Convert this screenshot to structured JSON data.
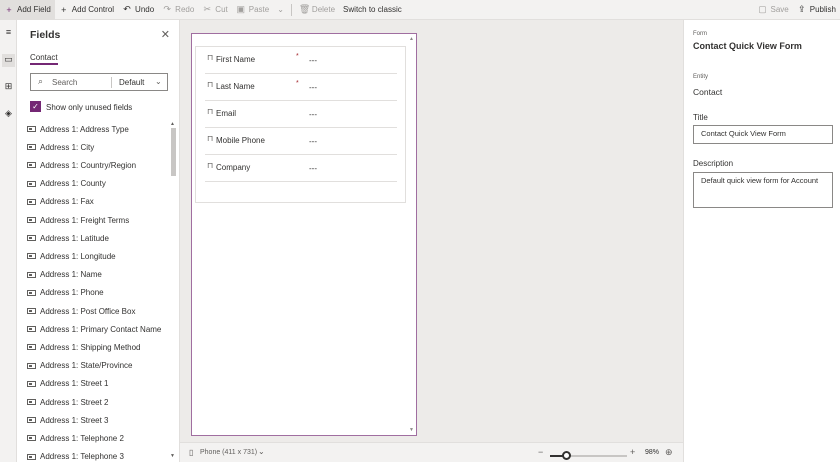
{
  "toolbar": {
    "add_field": "Add Field",
    "add_control": "Add Control",
    "undo": "Undo",
    "redo": "Redo",
    "cut": "Cut",
    "paste": "Paste",
    "delete": "Delete",
    "switch_classic": "Switch to classic",
    "save": "Save",
    "publish": "Publish"
  },
  "fields_pane": {
    "title": "Fields",
    "tab": "Contact",
    "search_placeholder": "Search",
    "filter_value": "Default",
    "show_unused_label": "Show only unused fields",
    "show_unused_checked": true,
    "items": [
      "Address 1: Address Type",
      "Address 1: City",
      "Address 1: Country/Region",
      "Address 1: County",
      "Address 1: Fax",
      "Address 1: Freight Terms",
      "Address 1: Latitude",
      "Address 1: Longitude",
      "Address 1: Name",
      "Address 1: Phone",
      "Address 1: Post Office Box",
      "Address 1: Primary Contact Name",
      "Address 1: Shipping Method",
      "Address 1: State/Province",
      "Address 1: Street 1",
      "Address 1: Street 2",
      "Address 1: Street 3",
      "Address 1: Telephone 2",
      "Address 1: Telephone 3"
    ]
  },
  "form": {
    "fields": [
      {
        "label": "First Name",
        "required_mark": "*",
        "value": "---"
      },
      {
        "label": "Last Name",
        "required_mark": "*",
        "value": "---"
      },
      {
        "label": "Email",
        "required_mark": "",
        "value": "---"
      },
      {
        "label": "Mobile Phone",
        "required_mark": "",
        "value": "---"
      },
      {
        "label": "Company",
        "required_mark": "",
        "value": "---"
      }
    ]
  },
  "bottom_bar": {
    "device": "Phone (411 x 731)",
    "zoom_pct": "98%",
    "zoom_level": 0.22
  },
  "properties": {
    "section_label": "Form",
    "form_name": "Contact Quick View Form",
    "entity_label": "Entity",
    "entity_value": "Contact",
    "title_label": "Title",
    "title_value": "Contact Quick View Form",
    "description_label": "Description",
    "description_value": "Default quick view form for Account"
  },
  "colors": {
    "accent": "#742774",
    "required": "#a4262c"
  }
}
